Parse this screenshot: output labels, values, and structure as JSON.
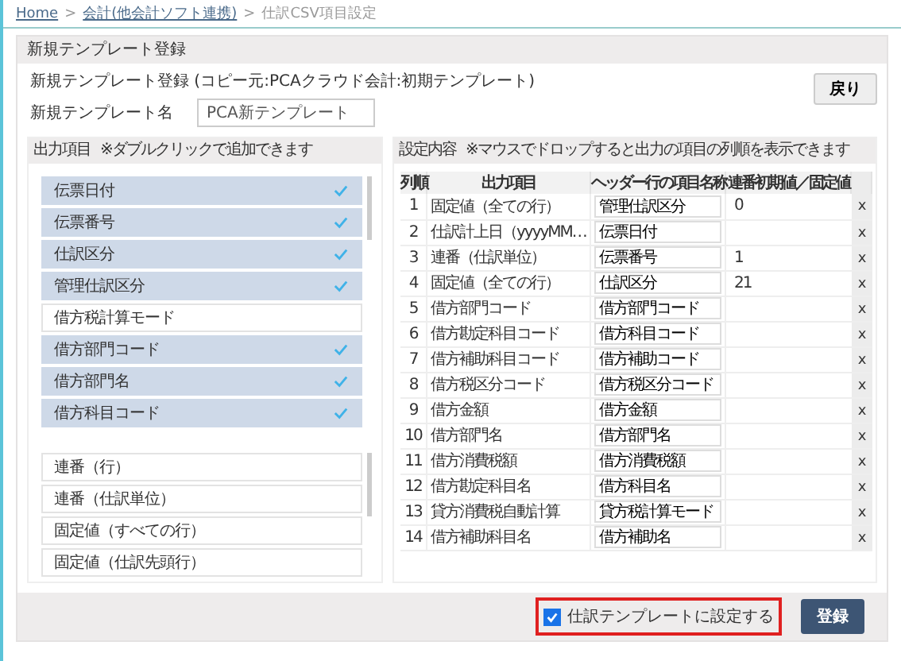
{
  "breadcrumb": [
    {
      "label": "Home",
      "link": true
    },
    {
      "label": "会計(他会計ソフト連携)",
      "link": true
    },
    {
      "label": "仕訳CSV項目設定",
      "link": false
    }
  ],
  "breadcrumb_separator": ">",
  "panel_title": "新規テンプレート登録",
  "info": "新規テンプレート登録 (コピー元:PCAクラウド会計:初期テンプレート)",
  "back_button": "戻り",
  "name_label": "新規テンプレート名",
  "name_value": "PCA新テンプレート",
  "output_items": {
    "title": "出力項目",
    "hint": "※ダブルクリックで追加できます",
    "items": [
      {
        "label": "伝票日付",
        "selected": true
      },
      {
        "label": "伝票番号",
        "selected": true
      },
      {
        "label": "仕訳区分",
        "selected": true
      },
      {
        "label": "管理仕訳区分",
        "selected": true
      },
      {
        "label": "借方税計算モード",
        "selected": false
      },
      {
        "label": "借方部門コード",
        "selected": true
      },
      {
        "label": "借方部門名",
        "selected": true
      },
      {
        "label": "借方科目コード",
        "selected": true
      }
    ],
    "special_items": [
      "連番（行）",
      "連番（仕訳単位）",
      "固定値（すべての行）",
      "固定値（仕訳先頭行）"
    ]
  },
  "settings": {
    "title": "設定内容",
    "hint": "※マウスでドロップすると出力の項目の列順を表示できます",
    "columns": [
      "列順",
      "出力項目",
      "ヘッダー行の項目名称",
      "連番初期値／固定値"
    ],
    "rows": [
      [
        "1",
        "固定値（全ての行）",
        "管理仕訳区分",
        "0",
        "x"
      ],
      [
        "2",
        "仕訳計上日（yyyyMM…",
        "伝票日付",
        "",
        "x"
      ],
      [
        "3",
        "連番（仕訳単位）",
        "伝票番号",
        "1",
        "x"
      ],
      [
        "4",
        "固定値（全ての行）",
        "仕訳区分",
        "21",
        "x"
      ],
      [
        "5",
        "借方部門コード",
        "借方部門コード",
        "",
        "x"
      ],
      [
        "6",
        "借方勘定科目コード",
        "借方科目コード",
        "",
        "x"
      ],
      [
        "7",
        "借方補助科目コード",
        "借方補助コード",
        "",
        "x"
      ],
      [
        "8",
        "借方税区分コード",
        "借方税区分コード",
        "",
        "x"
      ],
      [
        "9",
        "借方金額",
        "借方金額",
        "",
        "x"
      ],
      [
        "10",
        "借方部門名",
        "借方部門名",
        "",
        "x"
      ],
      [
        "11",
        "借方消費税額",
        "借方消費税額",
        "",
        "x"
      ],
      [
        "12",
        "借方勘定科目名",
        "借方科目名",
        "",
        "x"
      ],
      [
        "13",
        "貸方消費税自動計算",
        "貸方税計算モード",
        "",
        "x"
      ],
      [
        "14",
        "借方補助科目名",
        "借方補助名",
        "",
        "x"
      ]
    ]
  },
  "set_template": {
    "label": "仕訳テンプレートに設定する",
    "checked": true
  },
  "register_button": "登録"
}
